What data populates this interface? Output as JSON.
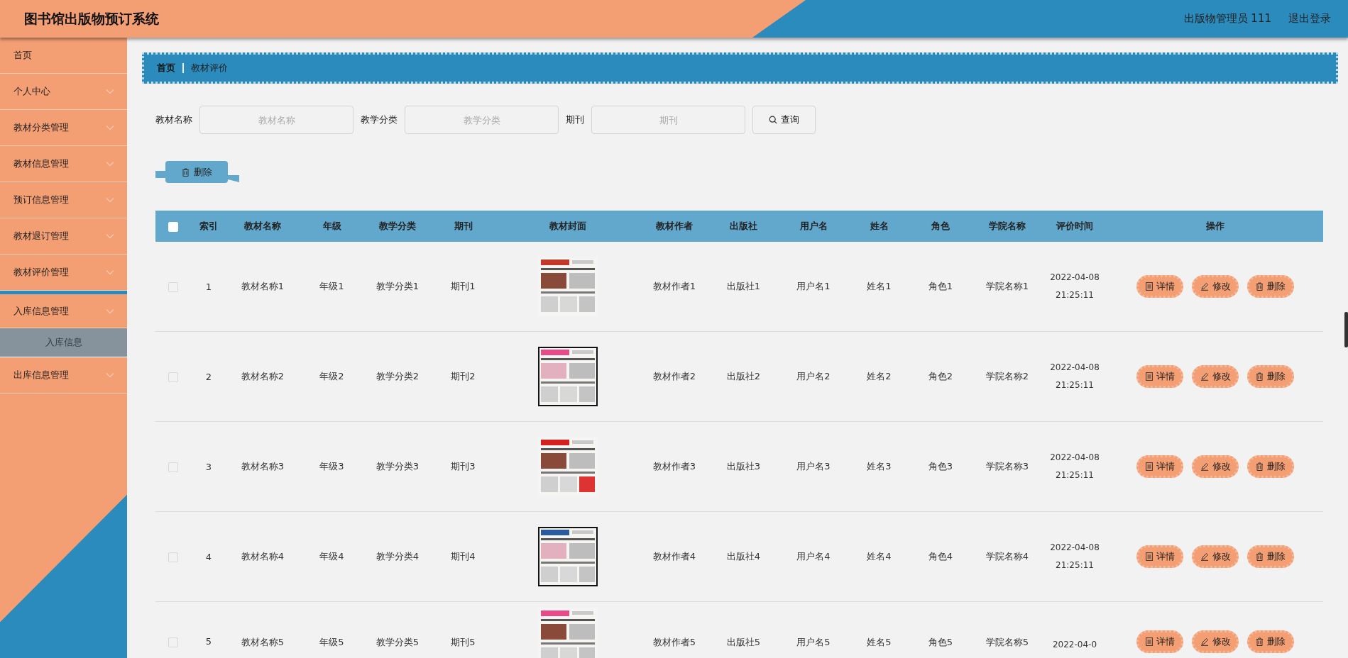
{
  "header": {
    "title": "图书馆出版物预订系统",
    "user": "出版物管理员 111",
    "logout": "退出登录"
  },
  "sidebar": {
    "items": [
      {
        "label": "首页",
        "kind": "link",
        "expanded": false
      },
      {
        "label": "个人中心",
        "kind": "menu",
        "expanded": false
      },
      {
        "label": "教材分类管理",
        "kind": "menu",
        "expanded": false
      },
      {
        "label": "教材信息管理",
        "kind": "menu",
        "expanded": false
      },
      {
        "label": "预订信息管理",
        "kind": "menu",
        "expanded": false
      },
      {
        "label": "教材退订管理",
        "kind": "menu",
        "expanded": false
      },
      {
        "label": "教材评价管理",
        "kind": "menu",
        "expanded": false
      },
      {
        "label": "入库信息管理",
        "kind": "menu",
        "expanded": true,
        "children": [
          {
            "label": "入库信息",
            "selected": true
          }
        ]
      },
      {
        "label": "出库信息管理",
        "kind": "menu",
        "expanded": false
      }
    ]
  },
  "breadcrumb": [
    {
      "label": "首页",
      "current": false
    },
    {
      "label": "教材评价",
      "current": true
    }
  ],
  "search": {
    "fields": [
      {
        "label": "教材名称",
        "placeholder": "教材名称"
      },
      {
        "label": "教学分类",
        "placeholder": "教学分类"
      },
      {
        "label": "期刊",
        "placeholder": "期刊"
      }
    ],
    "button": "查询"
  },
  "toolbar": {
    "delete": "删除"
  },
  "table": {
    "header_checked": false,
    "columns": [
      "索引",
      "教材名称",
      "年级",
      "教学分类",
      "期刊",
      "教材封面",
      "教材作者",
      "出版社",
      "用户名",
      "姓名",
      "角色",
      "学院名称",
      "评价时间",
      "操作"
    ],
    "rows": [
      {
        "checked": false,
        "cells": [
          "1",
          "教材名称1",
          "年级1",
          "教学分类1",
          "期刊1",
          "",
          "教材作者1",
          "出版社1",
          "用户名1",
          "姓名1",
          "角色1",
          "学院名称1",
          "2022-04-08 21:25:11"
        ],
        "cover": {
          "kind": "picture"
        },
        "actions": [
          {
            "kind": "detail",
            "label": "详情"
          },
          {
            "kind": "edit",
            "label": "修改"
          },
          {
            "kind": "delete",
            "label": "删除"
          }
        ]
      },
      {
        "checked": false,
        "cells": [
          "2",
          "教材名称2",
          "年级2",
          "教学分类2",
          "期刊2",
          "",
          "教材作者2",
          "出版社2",
          "用户名2",
          "姓名2",
          "角色2",
          "学院名称2",
          "2022-04-08 21:25:11"
        ],
        "cover": {
          "kind": "picture"
        },
        "actions": [
          {
            "kind": "detail",
            "label": "详情"
          },
          {
            "kind": "edit",
            "label": "修改"
          },
          {
            "kind": "delete",
            "label": "删除"
          }
        ]
      },
      {
        "checked": false,
        "cells": [
          "3",
          "教材名称3",
          "年级3",
          "教学分类3",
          "期刊3",
          "",
          "教材作者3",
          "出版社3",
          "用户名3",
          "姓名3",
          "角色3",
          "学院名称3",
          "2022-04-08 21:25:11"
        ],
        "cover": {
          "kind": "picture"
        },
        "actions": [
          {
            "kind": "detail",
            "label": "详情"
          },
          {
            "kind": "edit",
            "label": "修改"
          },
          {
            "kind": "delete",
            "label": "删除"
          }
        ]
      },
      {
        "checked": false,
        "cells": [
          "4",
          "教材名称4",
          "年级4",
          "教学分类4",
          "期刊4",
          "",
          "教材作者4",
          "出版社4",
          "用户名4",
          "姓名4",
          "角色4",
          "学院名称4",
          "2022-04-08 21:25:11"
        ],
        "cover": {
          "kind": "picture"
        },
        "actions": [
          {
            "kind": "detail",
            "label": "详情"
          },
          {
            "kind": "edit",
            "label": "修改"
          },
          {
            "kind": "delete",
            "label": "删除"
          }
        ]
      },
      {
        "checked": false,
        "cells": [
          "5",
          "教材名称5",
          "年级5",
          "教学分类5",
          "期刊5",
          "",
          "教材作者5",
          "出版社5",
          "用户名5",
          "姓名5",
          "角色5",
          "学院名称5",
          "2022-04-0"
        ],
        "cover": {
          "kind": "picture"
        },
        "actions": [
          {
            "kind": "detail",
            "label": "详情"
          },
          {
            "kind": "edit",
            "label": "修改"
          },
          {
            "kind": "delete",
            "label": "删除"
          }
        ]
      }
    ]
  }
}
